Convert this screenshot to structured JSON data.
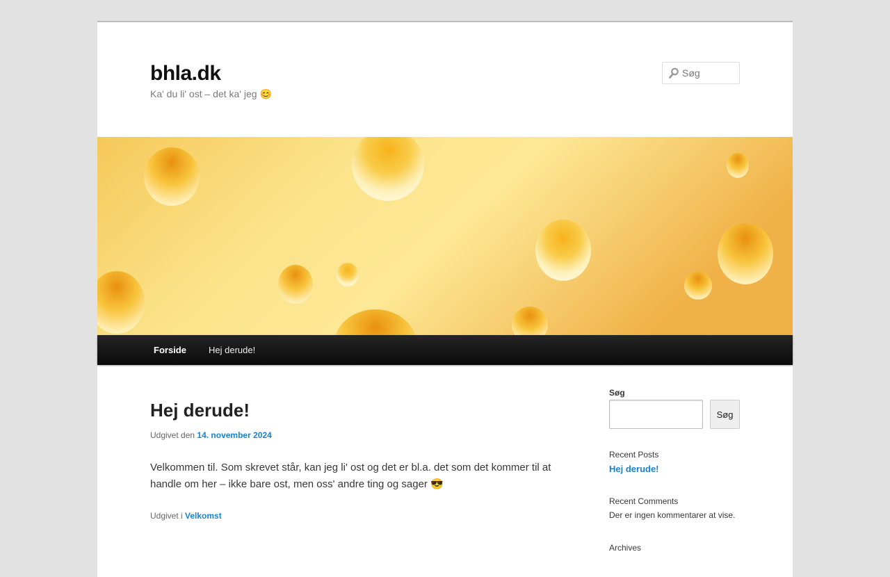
{
  "header": {
    "site_title": "bhla.dk",
    "site_description": "Ka' du li' ost – det ka' jeg 😊",
    "search_placeholder": "Søg"
  },
  "nav": {
    "items": [
      {
        "label": "Forside",
        "current": true
      },
      {
        "label": "Hej derude!",
        "current": false
      }
    ]
  },
  "post": {
    "title": "Hej derude!",
    "meta_prefix": "Udgivet den",
    "date": "14. november 2024",
    "body": "Velkommen til. Som skrevet står, kan jeg li' ost og det er bl.a. det som det kommer til at handle om her – ikke bare ost, men oss' andre ting og sager 😎",
    "category_prefix": "Udgivet i",
    "category": "Velkomst"
  },
  "sidebar": {
    "search_title": "Søg",
    "search_button": "Søg",
    "recent_posts_title": "Recent Posts",
    "recent_posts": [
      "Hej derude!"
    ],
    "recent_comments_title": "Recent Comments",
    "recent_comments_empty": "Der er ingen kommentarer at vise.",
    "archives_title": "Archives"
  },
  "colors": {
    "link": "#1982d1",
    "nav_bg": "#1a1a1a",
    "banner_base": "#f9df7a"
  },
  "icons": [
    "search-icon"
  ]
}
